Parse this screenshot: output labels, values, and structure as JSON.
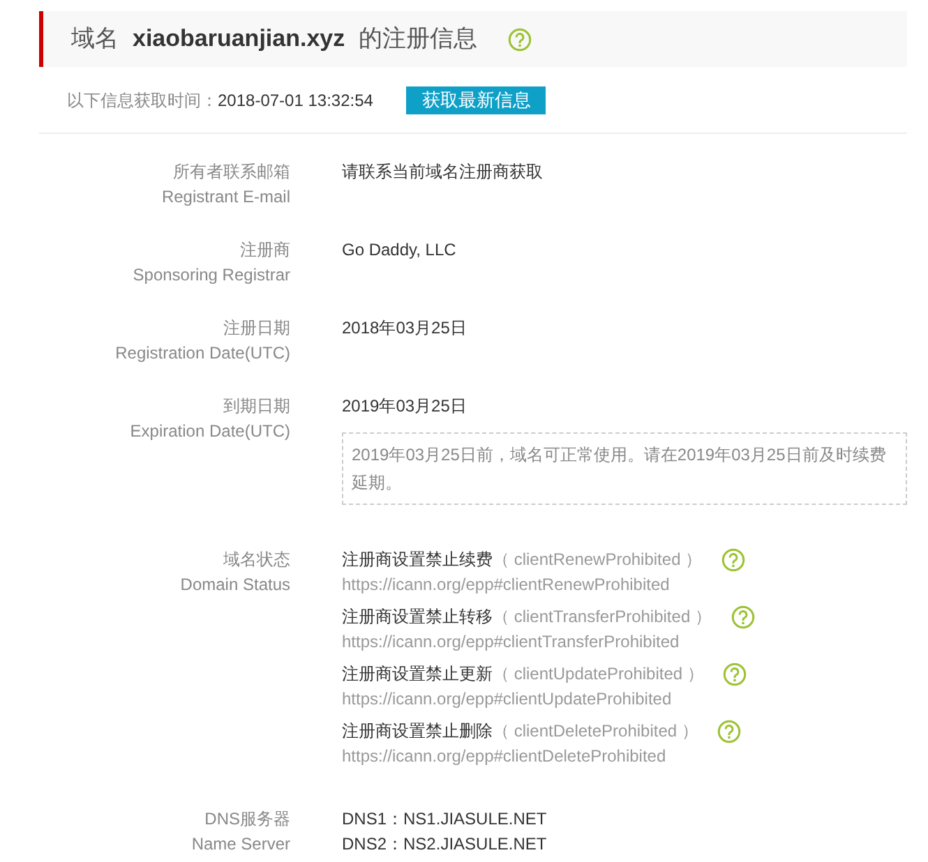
{
  "header": {
    "prefix": "域名",
    "domain": "xiaobaruanjian.xyz",
    "suffix": "的注册信息"
  },
  "fetch": {
    "label": "以下信息获取时间：",
    "time": "2018-07-01 13:32:54",
    "button": "获取最新信息"
  },
  "fields": [
    {
      "kind": "text",
      "label_cn": "所有者联系邮箱",
      "label_en": "Registrant E-mail",
      "value": "请联系当前域名注册商获取"
    },
    {
      "kind": "text",
      "label_cn": "注册商",
      "label_en": "Sponsoring Registrar",
      "value": "Go Daddy, LLC"
    },
    {
      "kind": "text",
      "label_cn": "注册日期",
      "label_en": "Registration Date(UTC)",
      "value": "2018年03月25日"
    },
    {
      "kind": "notice",
      "label_cn": "到期日期",
      "label_en": "Expiration Date(UTC)",
      "value": "2019年03月25日",
      "notice": "2019年03月25日前，域名可正常使用。请在2019年03月25日前及时续费延期。"
    },
    {
      "kind": "status",
      "label_cn": "域名状态",
      "label_en": "Domain Status",
      "statuses": [
        {
          "name": "注册商设置禁止续费",
          "code": "（ clientRenewProhibited ）",
          "url": "https://icann.org/epp#clientRenewProhibited"
        },
        {
          "name": "注册商设置禁止转移",
          "code": "（ clientTransferProhibited ）",
          "url": "https://icann.org/epp#clientTransferProhibited"
        },
        {
          "name": "注册商设置禁止更新",
          "code": "（ clientUpdateProhibited ）",
          "url": "https://icann.org/epp#clientUpdateProhibited"
        },
        {
          "name": "注册商设置禁止删除",
          "code": "（ clientDeleteProhibited ）",
          "url": "https://icann.org/epp#clientDeleteProhibited"
        }
      ]
    },
    {
      "kind": "list",
      "label_cn": "DNS服务器",
      "label_en": "Name Server",
      "values": [
        "DNS1：NS1.JIASULE.NET",
        "DNS2：NS2.JIASULE.NET"
      ]
    }
  ]
}
